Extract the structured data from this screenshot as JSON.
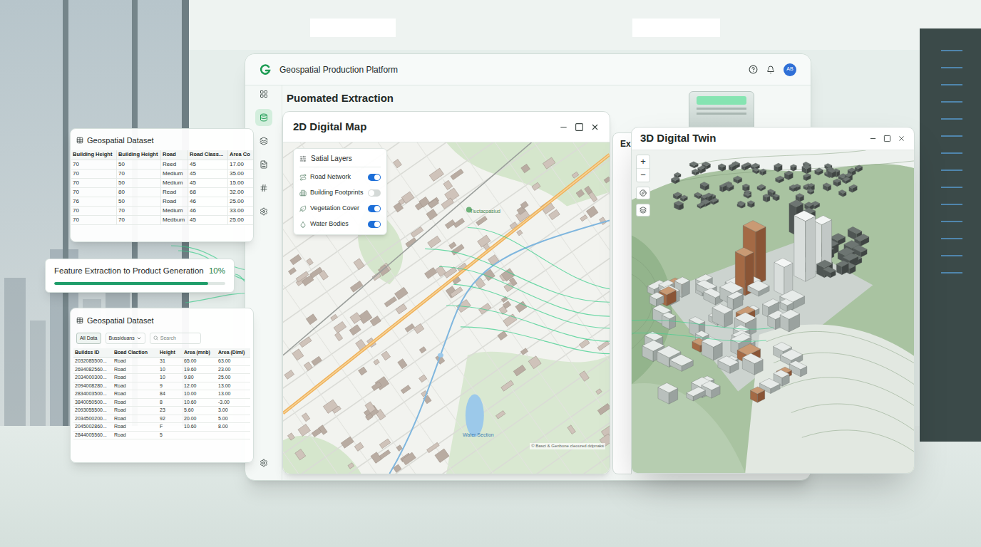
{
  "main_window": {
    "title": "Geospatial Production Platform",
    "avatar": "AB",
    "heading": "Puomated Extraction",
    "sidebar": [
      {
        "selected": false
      },
      {
        "selected": true
      },
      {
        "selected": false
      },
      {
        "selected": false
      },
      {
        "selected": false
      },
      {
        "selected": false
      },
      {
        "selected": false
      }
    ]
  },
  "map_window": {
    "title": "2D Digital Map",
    "layers_panel": {
      "title": "Satial Layers",
      "layers": [
        {
          "label": "Road Network",
          "kind": "road",
          "on": true
        },
        {
          "label": "Building Footprints",
          "kind": "building",
          "on": false
        },
        {
          "label": "Vegetation Cover",
          "kind": "vegetation",
          "on": true
        },
        {
          "label": "Water Bodies",
          "kind": "water",
          "on": true
        }
      ]
    },
    "labels": [
      {
        "text": "Tiuctacoasiud",
        "kind": "park"
      },
      {
        "text": "Water Section",
        "kind": "water"
      }
    ],
    "attribution": "© Basci & Genbone cleoured ddpnaks"
  },
  "hidden_window": {
    "title": "Ex"
  },
  "twin_window": {
    "title": "3D Digital Twin",
    "zoom_in": "+",
    "zoom_out": "−"
  },
  "top_dataset": {
    "title": "Geospatial Dataset",
    "columns": [
      "Building Height",
      "Building Height",
      "Road",
      "Road Class...",
      "Area Co"
    ],
    "rows": [
      [
        "70",
        "50",
        "Reed",
        "45",
        "17.00"
      ],
      [
        "70",
        "70",
        "Medium",
        "45",
        "35.00"
      ],
      [
        "70",
        "50",
        "Medium",
        "45",
        "15.00"
      ],
      [
        "70",
        "80",
        "Read",
        "68",
        "32.00"
      ],
      [
        "76",
        "50",
        "Road",
        "46",
        "25.00"
      ],
      [
        "70",
        "70",
        "Medium",
        "46",
        "33.00"
      ],
      [
        "70",
        "70",
        "Medbum",
        "45",
        "25.00"
      ]
    ]
  },
  "progress": {
    "label": "Feature Extraction to Product Generation",
    "reading": "10%",
    "level": 0.9
  },
  "bottom_dataset": {
    "title": "Geospatial Dataset",
    "filter": {
      "label": "All Data",
      "selected": true
    },
    "dropdown": "Bussiduans",
    "search": {
      "placeholder": "Search"
    },
    "columns": [
      "Buildss ID",
      "Boad Claction",
      "Height",
      "Area (mnb)",
      "Area (Diml)"
    ],
    "rows": [
      [
        "2032085500...",
        "Road",
        "31",
        "65.00",
        "63.00"
      ],
      [
        "2694082560...",
        "Road",
        "10",
        "19.60",
        "23.00"
      ],
      [
        "2034000300...",
        "Road",
        "10",
        "9.80",
        "25.00"
      ],
      [
        "2094008280...",
        "Road",
        "9",
        "12.00",
        "13.00"
      ],
      [
        "2834003500...",
        "Road",
        "84",
        "10.00",
        "13.00"
      ],
      [
        "3840050500...",
        "Road",
        "8",
        "10.60",
        "-3.00"
      ],
      [
        "2093055500...",
        "Road",
        "23",
        "5.60",
        "3.00"
      ],
      [
        "2034500200...",
        "Road",
        "92",
        "20.00",
        "5.00"
      ],
      [
        "2045002860...",
        "Road",
        "F",
        "10.60",
        "8.00"
      ],
      [
        "2844005560...",
        "Road",
        "5"
      ]
    ]
  }
}
